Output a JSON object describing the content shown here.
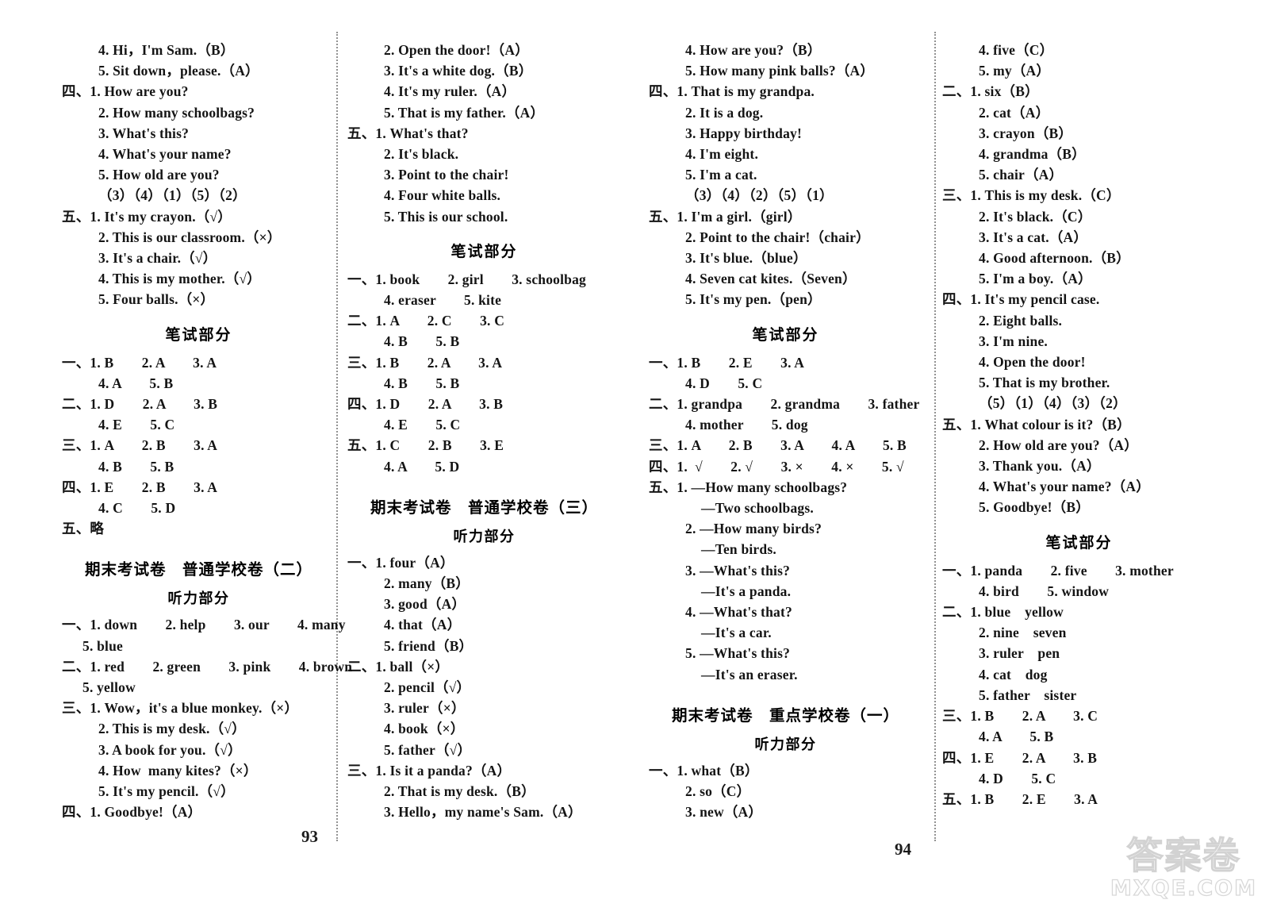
{
  "page": {
    "left_page_number": "93",
    "right_page_number": "94",
    "watermark_cn": "答案卷",
    "watermark_en": "MXQE.COM"
  },
  "headers": {
    "written_part": "笔试部分",
    "listening_part": "听力部分",
    "paper_common_2": "期末考试卷　普通学校卷（二）",
    "paper_common_3": "期末考试卷　普通学校卷（三）",
    "paper_key_1": "期末考试卷　重点学校卷（一）"
  },
  "col1": {
    "lines": [
      "4. Hi，I'm Sam.（B）",
      "5. Sit down，please.（A）",
      "四、1. How are you?",
      "2. How many schoolbags?",
      "3. What's this?",
      "4. What's your name?",
      "5. How old are you?",
      "（3）（4）（1）（5）（2）",
      "五、1. It's my crayon.（√）",
      "2. This is our classroom.（×）",
      "3. It's a chair.（√）",
      "4. This is my mother.（√）",
      "5. Four balls.（×）"
    ],
    "written": [
      "一、1. B　　2. A　　3. A",
      "4. A　　5. B",
      "二、1. D　　2. A　　3. B",
      "4. E　　5. C",
      "三、1. A　　2. B　　3. A",
      "4. B　　5. B",
      "四、1. E　　2. B　　3. A",
      "4. C　　5. D",
      "五、略"
    ],
    "listening2": [
      "一、1. down　　2. help　　3. our　　4. many",
      "5. blue",
      "二、1. red　　2. green　　3. pink　　4. brown",
      "5. yellow",
      "三、1. Wow，it's a blue monkey.（×）",
      "2. This is my desk.（√）",
      "3. A book for you.（√）",
      "4. How  many kites?（×）",
      "5. It's my pencil.（√）",
      "四、1. Goodbye!（A）"
    ]
  },
  "col2": {
    "lines": [
      "2. Open the door!（A）",
      "3. It's a white dog.（B）",
      "4. It's my ruler.（A）",
      "5. That is my father.（A）",
      "五、1. What's that?",
      "2. It's black.",
      "3. Point to the chair!",
      "4. Four white balls.",
      "5. This is our school."
    ],
    "written": [
      "一、1. book　　2. girl　　3. schoolbag",
      "4. eraser　　5. kite",
      "二、1. A　　2. C　　3. C",
      "4. B　　5. B",
      "三、1. B　　2. A　　3. A",
      "4. B　　5. B",
      "四、1. D　　2. A　　3. B",
      "4. E　　5. C",
      "五、1. C　　2. B　　3. E",
      "4. A　　5. D"
    ],
    "listening3": [
      "一、1. four（A）",
      "2. many（B）",
      "3. good（A）",
      "4. that（A）",
      "5. friend（B）",
      "二、1. ball（×）",
      "2. pencil（√）",
      "3. ruler（×）",
      "4. book（×）",
      "5. father（√）",
      "三、1. Is it a panda?（A）",
      "2. That is my desk.（B）",
      "3. Hello，my name's Sam.（A）"
    ]
  },
  "col3": {
    "lines": [
      "4. How are you?（B）",
      "5. How many pink balls?（A）",
      "四、1. That is my grandpa.",
      "2. It is a dog.",
      "3. Happy birthday!",
      "4. I'm eight.",
      "5. I'm a cat.",
      "（3）（4）（2）（5）（1）",
      "五、1. I'm a girl.（girl）",
      "2. Point to the chair!（chair）",
      "3. It's blue.（blue）",
      "4. Seven cat kites.（Seven）",
      "5. It's my pen.（pen）"
    ],
    "written": [
      "一、1. B　　2. E　　3. A",
      "4. D　　5. C",
      "二、1. grandpa　　2. grandma　　3. father",
      "4. mother　　5. dog",
      "三、1. A　　2. B　　3. A　　4. A　　5. B",
      "四、1.  √　　2. √　　3. ×　　4. ×　　5. √",
      "五、1. —How many schoolbags?",
      "—Two schoolbags.",
      "2. —How many birds?",
      "—Ten birds.",
      "3. —What's this?",
      "—It's a panda.",
      "4. —What's that?",
      "—It's a car.",
      "5. —What's this?",
      "—It's an eraser."
    ],
    "listening_key1": [
      "一、1. what（B）",
      "2. so（C）",
      "3. new（A）"
    ]
  },
  "col4": {
    "lines": [
      "4. five（C）",
      "5. my（A）",
      "二、1. six（B）",
      "2. cat（A）",
      "3. crayon（B）",
      "4. grandma（B）",
      "5. chair（A）",
      "三、1. This is my desk.（C）",
      "2. It's black.（C）",
      "3. It's a cat.（A）",
      "4. Good afternoon.（B）",
      "5. I'm a boy.（A）",
      "四、1. It's my pencil case.",
      "2. Eight balls.",
      "3. I'm nine.",
      "4. Open the door!",
      "5. That is my brother.",
      "（5）（1）（4）（3）（2）",
      "五、1. What colour is it?（B）",
      "2. How old are you?（A）",
      "3. Thank you.（A）",
      "4. What's your name?（A）",
      "5. Goodbye!（B）"
    ],
    "written": [
      "一、1. panda　　2. five　　3. mother",
      "4. bird　　5. window",
      "二、1. blue　yellow",
      "2. nine　seven",
      "3. ruler　pen",
      "4. cat　dog",
      "5. father　sister",
      "三、1. B　　2. A　　3. C",
      "4. A　　5. B",
      "四、1. E　　2. A　　3. B",
      "4. D　　5. C",
      "五、1. B　　2. E　　3. A"
    ]
  }
}
